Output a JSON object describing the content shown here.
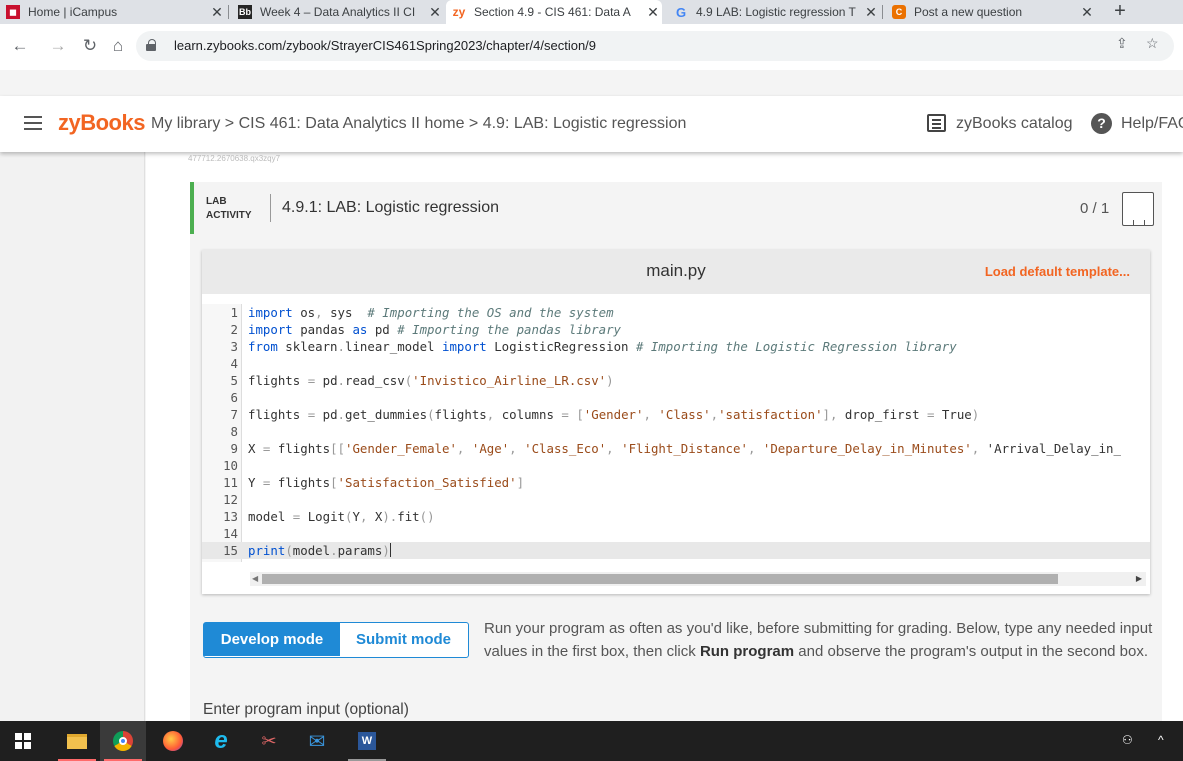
{
  "browser": {
    "tabs": [
      {
        "title": "Home | iCampus",
        "favicon": "icampus-logo",
        "active": false
      },
      {
        "title": "Week 4 – Data Analytics II CI",
        "favicon": "Bb",
        "active": false
      },
      {
        "title": "Section 4.9 - CIS 461: Data A",
        "favicon": "zy",
        "active": true
      },
      {
        "title": "4.9 LAB: Logistic regression T",
        "favicon": "G",
        "active": false
      },
      {
        "title": "Post a new question",
        "favicon": "C",
        "active": false
      }
    ],
    "new_tab": "+",
    "url": "learn.zybooks.com/zybook/StrayerCIS461Spring2023/chapter/4/section/9"
  },
  "header": {
    "logo": "zyBooks",
    "breadcrumb": "My library > CIS 461: Data Analytics II home > 4.9: LAB: Logistic regression",
    "catalog": "zyBooks catalog",
    "help": "Help/FAQ"
  },
  "tracking_code": "477712.2670638.qx3zqy7",
  "activity": {
    "tag_line1": "LAB",
    "tag_line2": "ACTIVITY",
    "title": "4.9.1: LAB: Logistic regression",
    "score": "0 / 1"
  },
  "editor": {
    "filename": "main.py",
    "load_template": "Load default template...",
    "lines": [
      "import os, sys  # Importing the OS and the system",
      "import pandas as pd # Importing the pandas library",
      "from sklearn.linear_model import LogisticRegression # Importing the Logistic Regression library",
      "",
      "flights = pd.read_csv('Invistico_Airline_LR.csv')",
      "",
      "flights = pd.get_dummies(flights, columns = ['Gender', 'Class','satisfaction'], drop_first = True)",
      "",
      "X = flights[['Gender_Female', 'Age', 'Class_Eco', 'Flight_Distance', 'Departure_Delay_in_Minutes', 'Arrival_Delay_in_",
      "",
      "Y = flights['Satisfaction_Satisfied']",
      "",
      "model = Logit(Y, X).fit()",
      "",
      "print(model.params)"
    ]
  },
  "modes": {
    "develop": "Develop mode",
    "submit": "Submit mode",
    "help_part1": "Run your program as often as you'd like, before submitting for grading. Below, type any needed input values in the first box, then click ",
    "help_bold": "Run program",
    "help_part2": " and observe the program's output in the second box."
  },
  "input_label": "Enter program input (optional)",
  "taskbar": {
    "items": [
      "windows-start",
      "file-explorer",
      "chrome",
      "firefox",
      "internet-explorer",
      "snipping-tool",
      "mail",
      "word"
    ],
    "tray_people": "⚇",
    "tray_chevron": "^"
  }
}
